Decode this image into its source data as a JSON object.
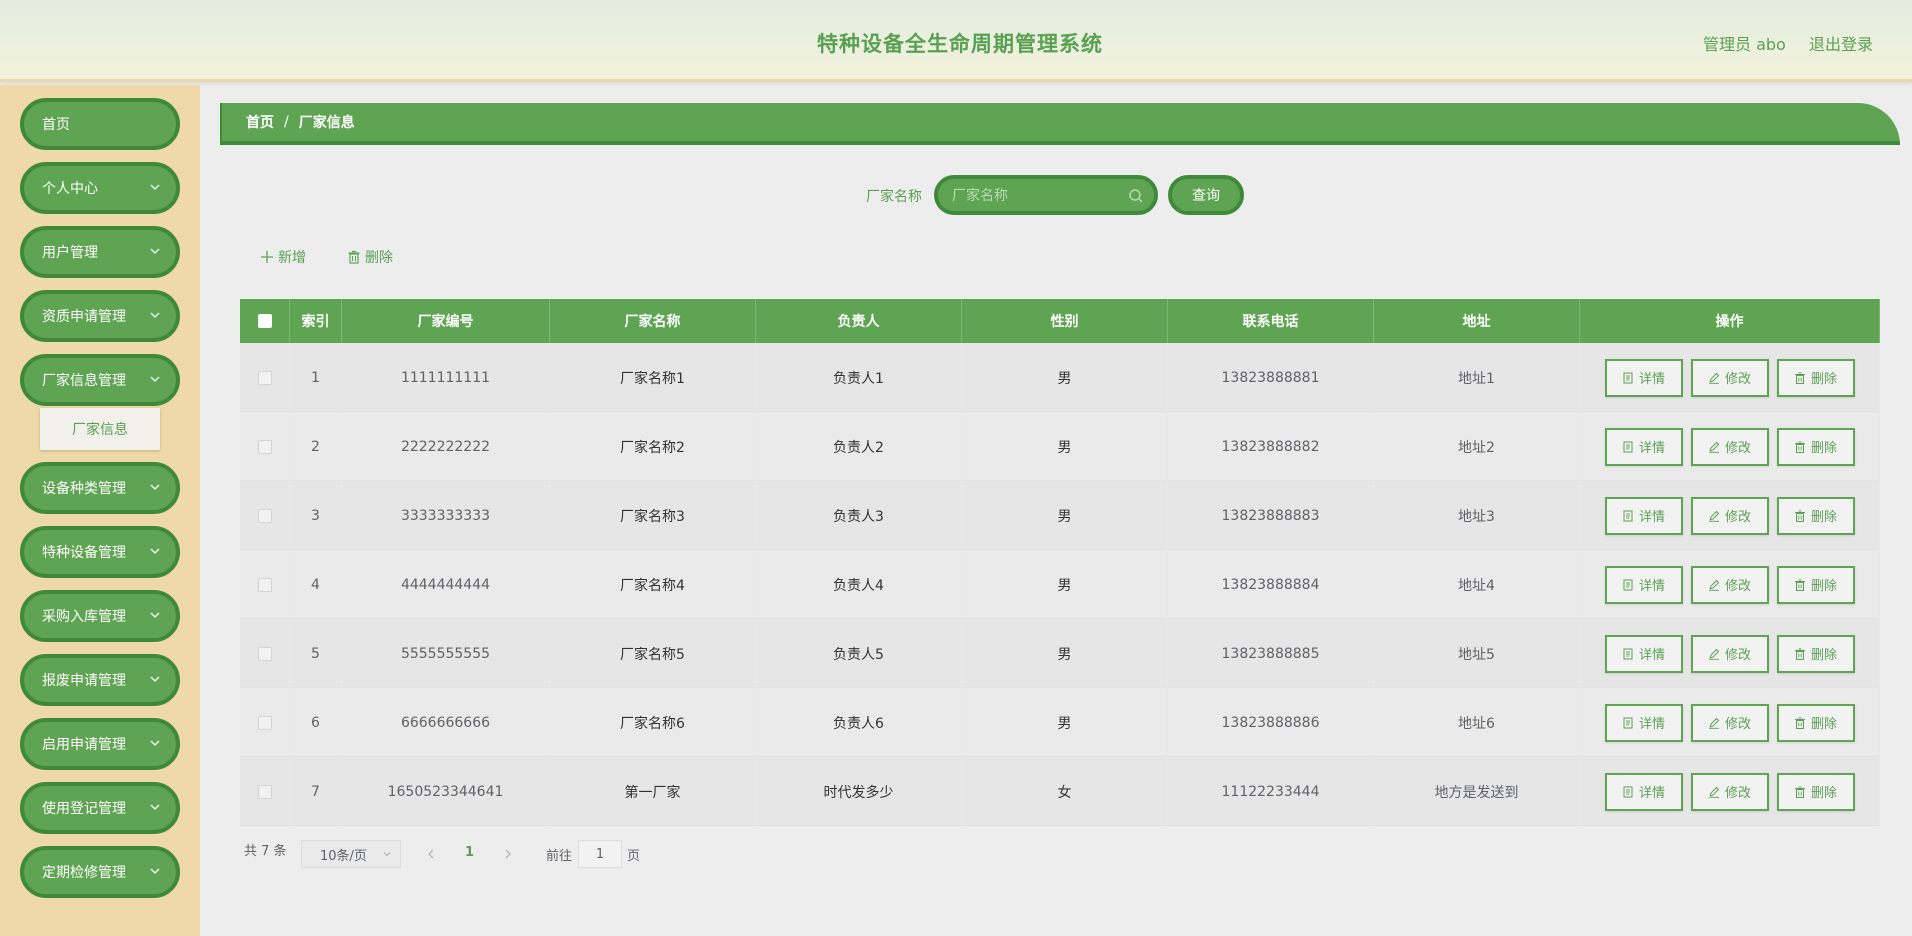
{
  "header": {
    "title": "特种设备全生命周期管理系统",
    "user": "管理员 abo",
    "logout": "退出登录"
  },
  "sidebar": {
    "items": [
      {
        "label": "首页",
        "has_arrow": false
      },
      {
        "label": "个人中心",
        "has_arrow": true
      },
      {
        "label": "用户管理",
        "has_arrow": true
      },
      {
        "label": "资质申请管理",
        "has_arrow": true
      },
      {
        "label": "厂家信息管理",
        "has_arrow": true
      },
      {
        "label": "设备种类管理",
        "has_arrow": true
      },
      {
        "label": "特种设备管理",
        "has_arrow": true
      },
      {
        "label": "采购入库管理",
        "has_arrow": true
      },
      {
        "label": "报废申请管理",
        "has_arrow": true
      },
      {
        "label": "启用申请管理",
        "has_arrow": true
      },
      {
        "label": "使用登记管理",
        "has_arrow": true
      },
      {
        "label": "定期检修管理",
        "has_arrow": true
      }
    ],
    "submenu": "厂家信息"
  },
  "breadcrumb": {
    "home": "首页",
    "sep": "/",
    "current": "厂家信息"
  },
  "search": {
    "label": "厂家名称",
    "placeholder": "厂家名称",
    "button": "查询"
  },
  "toolbar": {
    "add": "新增",
    "delete": "删除"
  },
  "table": {
    "headers": [
      "索引",
      "厂家编号",
      "厂家名称",
      "负责人",
      "性别",
      "联系电话",
      "地址",
      "操作"
    ],
    "rows": [
      {
        "index": "1",
        "code": "1111111111",
        "name": "厂家名称1",
        "person": "负责人1",
        "gender": "男",
        "phone": "13823888881",
        "address": "地址1"
      },
      {
        "index": "2",
        "code": "2222222222",
        "name": "厂家名称2",
        "person": "负责人2",
        "gender": "男",
        "phone": "13823888882",
        "address": "地址2"
      },
      {
        "index": "3",
        "code": "3333333333",
        "name": "厂家名称3",
        "person": "负责人3",
        "gender": "男",
        "phone": "13823888883",
        "address": "地址3"
      },
      {
        "index": "4",
        "code": "4444444444",
        "name": "厂家名称4",
        "person": "负责人4",
        "gender": "男",
        "phone": "13823888884",
        "address": "地址4"
      },
      {
        "index": "5",
        "code": "5555555555",
        "name": "厂家名称5",
        "person": "负责人5",
        "gender": "男",
        "phone": "13823888885",
        "address": "地址5"
      },
      {
        "index": "6",
        "code": "6666666666",
        "name": "厂家名称6",
        "person": "负责人6",
        "gender": "男",
        "phone": "13823888886",
        "address": "地址6"
      },
      {
        "index": "7",
        "code": "1650523344641",
        "name": "第一厂家",
        "person": "时代发多少",
        "gender": "女",
        "phone": "11122233444",
        "address": "地方是发送到"
      }
    ],
    "actions": {
      "detail": "详情",
      "edit": "修改",
      "delete": "删除"
    }
  },
  "pagination": {
    "total": "共 7 条",
    "page_size": "10条/页",
    "current_page": "1",
    "goto_prefix": "前往",
    "goto_value": "1",
    "goto_suffix": "页"
  },
  "colors": {
    "primary": "#5fa452",
    "primary_dark": "#3f8a3a",
    "sidebar_bg": "#efd9a8",
    "text_accent": "#5aa053"
  }
}
